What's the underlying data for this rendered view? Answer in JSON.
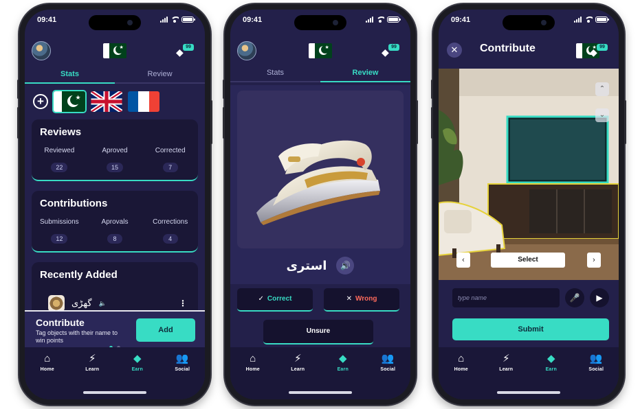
{
  "status": {
    "time": "09:41"
  },
  "header": {
    "gem_count": "99"
  },
  "colors": {
    "accent": "#38dcc4",
    "background": "#23204a",
    "card": "#1a1736",
    "wrong": "#ff6a5c"
  },
  "phone1": {
    "tabs": [
      {
        "label": "Stats",
        "active": true
      },
      {
        "label": "Review",
        "active": false
      }
    ],
    "reviews": {
      "title": "Reviews",
      "cols": [
        {
          "label": "Reviewed",
          "value": "22"
        },
        {
          "label": "Aproved",
          "value": "15"
        },
        {
          "label": "Corrected",
          "value": "7"
        }
      ]
    },
    "contributions": {
      "title": "Contributions",
      "cols": [
        {
          "label": "Submissions",
          "value": "12"
        },
        {
          "label": "Aprovals",
          "value": "8"
        },
        {
          "label": "Corrections",
          "value": "4"
        }
      ]
    },
    "recent": {
      "title": "Recently Added",
      "word": "گھڑی"
    },
    "contribute": {
      "title": "Contribute",
      "desc": "Tag objects with their name to win points",
      "button": "Add"
    }
  },
  "phone2": {
    "tabs": [
      {
        "label": "Stats",
        "active": false
      },
      {
        "label": "Review",
        "active": true
      }
    ],
    "word": "استری",
    "buttons": {
      "correct": "Correct",
      "wrong": "Wrong",
      "unsure": "Unsure"
    }
  },
  "phone3": {
    "title": "Contribute",
    "select_label": "Select",
    "input_placeholder": "type name",
    "submit": "Submit"
  },
  "nav": [
    {
      "label": "Home",
      "icon": "home-icon"
    },
    {
      "label": "Learn",
      "icon": "lightning-icon"
    },
    {
      "label": "Earn",
      "icon": "gem-icon"
    },
    {
      "label": "Social",
      "icon": "people-icon"
    }
  ]
}
